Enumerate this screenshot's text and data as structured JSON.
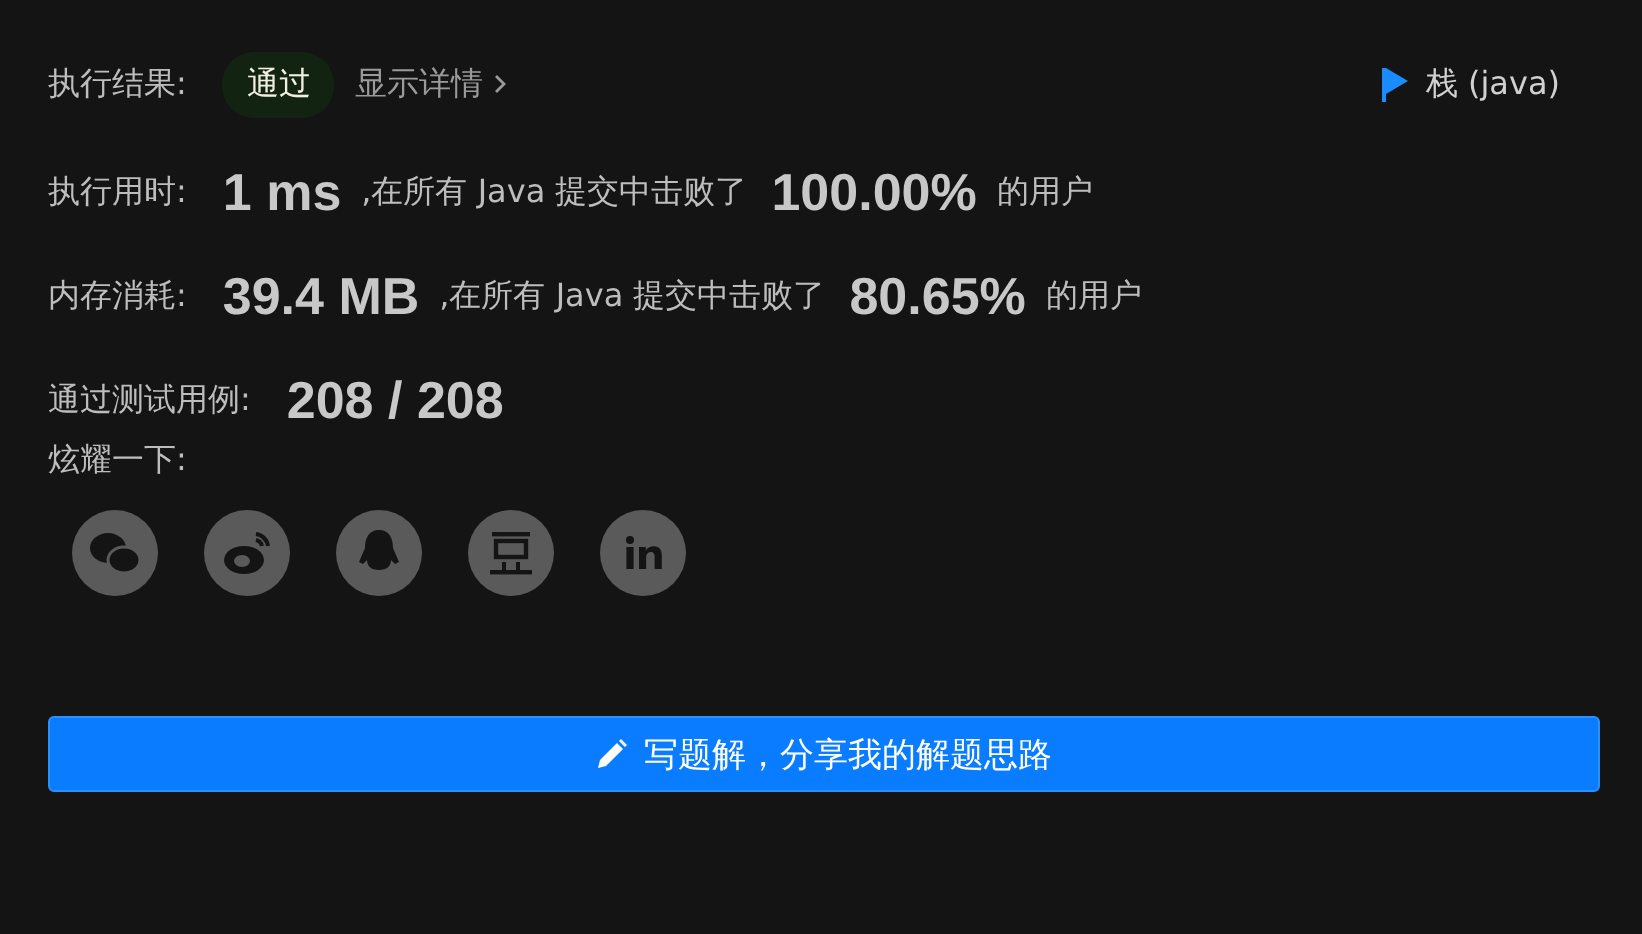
{
  "result": {
    "label": "执行结果:",
    "status": "通过",
    "details_link": "显示详情",
    "tag": "栈 (java)"
  },
  "stats": [
    {
      "label": "执行用时:",
      "value": "1 ms",
      "text": ",在所有 Java 提交中击败了",
      "percent": "100.00%",
      "suffix": "的用户"
    },
    {
      "label": "内存消耗:",
      "value": "39.4 MB",
      "text": ",在所有 Java 提交中击败了",
      "percent": "80.65%",
      "suffix": "的用户"
    }
  ],
  "tests": {
    "label": "通过测试用例:",
    "value": "208 / 208"
  },
  "share": {
    "label": "炫耀一下:"
  },
  "write_button": "写题解，分享我的解题思路"
}
